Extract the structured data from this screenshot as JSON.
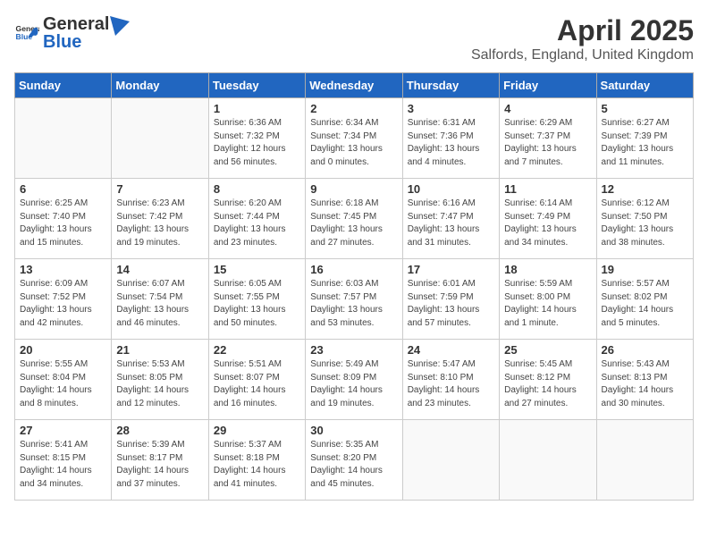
{
  "header": {
    "logo_general": "General",
    "logo_blue": "Blue",
    "title": "April 2025",
    "subtitle": "Salfords, England, United Kingdom"
  },
  "days_of_week": [
    "Sunday",
    "Monday",
    "Tuesday",
    "Wednesday",
    "Thursday",
    "Friday",
    "Saturday"
  ],
  "weeks": [
    [
      {
        "day": "",
        "info": ""
      },
      {
        "day": "",
        "info": ""
      },
      {
        "day": "1",
        "info": "Sunrise: 6:36 AM\nSunset: 7:32 PM\nDaylight: 12 hours and 56 minutes."
      },
      {
        "day": "2",
        "info": "Sunrise: 6:34 AM\nSunset: 7:34 PM\nDaylight: 13 hours and 0 minutes."
      },
      {
        "day": "3",
        "info": "Sunrise: 6:31 AM\nSunset: 7:36 PM\nDaylight: 13 hours and 4 minutes."
      },
      {
        "day": "4",
        "info": "Sunrise: 6:29 AM\nSunset: 7:37 PM\nDaylight: 13 hours and 7 minutes."
      },
      {
        "day": "5",
        "info": "Sunrise: 6:27 AM\nSunset: 7:39 PM\nDaylight: 13 hours and 11 minutes."
      }
    ],
    [
      {
        "day": "6",
        "info": "Sunrise: 6:25 AM\nSunset: 7:40 PM\nDaylight: 13 hours and 15 minutes."
      },
      {
        "day": "7",
        "info": "Sunrise: 6:23 AM\nSunset: 7:42 PM\nDaylight: 13 hours and 19 minutes."
      },
      {
        "day": "8",
        "info": "Sunrise: 6:20 AM\nSunset: 7:44 PM\nDaylight: 13 hours and 23 minutes."
      },
      {
        "day": "9",
        "info": "Sunrise: 6:18 AM\nSunset: 7:45 PM\nDaylight: 13 hours and 27 minutes."
      },
      {
        "day": "10",
        "info": "Sunrise: 6:16 AM\nSunset: 7:47 PM\nDaylight: 13 hours and 31 minutes."
      },
      {
        "day": "11",
        "info": "Sunrise: 6:14 AM\nSunset: 7:49 PM\nDaylight: 13 hours and 34 minutes."
      },
      {
        "day": "12",
        "info": "Sunrise: 6:12 AM\nSunset: 7:50 PM\nDaylight: 13 hours and 38 minutes."
      }
    ],
    [
      {
        "day": "13",
        "info": "Sunrise: 6:09 AM\nSunset: 7:52 PM\nDaylight: 13 hours and 42 minutes."
      },
      {
        "day": "14",
        "info": "Sunrise: 6:07 AM\nSunset: 7:54 PM\nDaylight: 13 hours and 46 minutes."
      },
      {
        "day": "15",
        "info": "Sunrise: 6:05 AM\nSunset: 7:55 PM\nDaylight: 13 hours and 50 minutes."
      },
      {
        "day": "16",
        "info": "Sunrise: 6:03 AM\nSunset: 7:57 PM\nDaylight: 13 hours and 53 minutes."
      },
      {
        "day": "17",
        "info": "Sunrise: 6:01 AM\nSunset: 7:59 PM\nDaylight: 13 hours and 57 minutes."
      },
      {
        "day": "18",
        "info": "Sunrise: 5:59 AM\nSunset: 8:00 PM\nDaylight: 14 hours and 1 minute."
      },
      {
        "day": "19",
        "info": "Sunrise: 5:57 AM\nSunset: 8:02 PM\nDaylight: 14 hours and 5 minutes."
      }
    ],
    [
      {
        "day": "20",
        "info": "Sunrise: 5:55 AM\nSunset: 8:04 PM\nDaylight: 14 hours and 8 minutes."
      },
      {
        "day": "21",
        "info": "Sunrise: 5:53 AM\nSunset: 8:05 PM\nDaylight: 14 hours and 12 minutes."
      },
      {
        "day": "22",
        "info": "Sunrise: 5:51 AM\nSunset: 8:07 PM\nDaylight: 14 hours and 16 minutes."
      },
      {
        "day": "23",
        "info": "Sunrise: 5:49 AM\nSunset: 8:09 PM\nDaylight: 14 hours and 19 minutes."
      },
      {
        "day": "24",
        "info": "Sunrise: 5:47 AM\nSunset: 8:10 PM\nDaylight: 14 hours and 23 minutes."
      },
      {
        "day": "25",
        "info": "Sunrise: 5:45 AM\nSunset: 8:12 PM\nDaylight: 14 hours and 27 minutes."
      },
      {
        "day": "26",
        "info": "Sunrise: 5:43 AM\nSunset: 8:13 PM\nDaylight: 14 hours and 30 minutes."
      }
    ],
    [
      {
        "day": "27",
        "info": "Sunrise: 5:41 AM\nSunset: 8:15 PM\nDaylight: 14 hours and 34 minutes."
      },
      {
        "day": "28",
        "info": "Sunrise: 5:39 AM\nSunset: 8:17 PM\nDaylight: 14 hours and 37 minutes."
      },
      {
        "day": "29",
        "info": "Sunrise: 5:37 AM\nSunset: 8:18 PM\nDaylight: 14 hours and 41 minutes."
      },
      {
        "day": "30",
        "info": "Sunrise: 5:35 AM\nSunset: 8:20 PM\nDaylight: 14 hours and 45 minutes."
      },
      {
        "day": "",
        "info": ""
      },
      {
        "day": "",
        "info": ""
      },
      {
        "day": "",
        "info": ""
      }
    ]
  ]
}
